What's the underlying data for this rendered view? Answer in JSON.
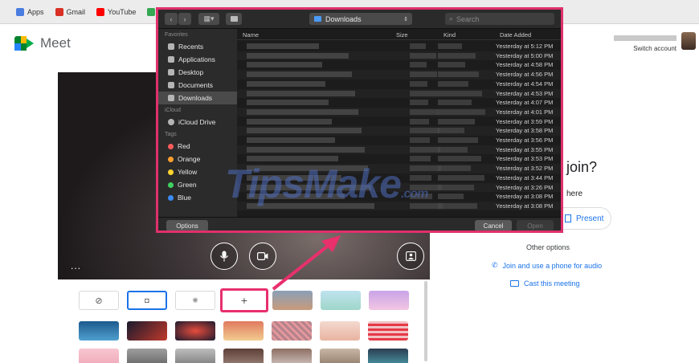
{
  "bookmarks": [
    {
      "label": "Apps",
      "color": "#4a7de0",
      "icon": "apps-grid-icon"
    },
    {
      "label": "Gmail",
      "color": "#d93025",
      "icon": "gmail-icon"
    },
    {
      "label": "YouTube",
      "color": "#ff0000",
      "icon": "youtube-icon"
    },
    {
      "label": "Maps",
      "color": "#34a853",
      "icon": "maps-icon"
    }
  ],
  "meet": {
    "app_name": "Meet",
    "switch_account": "Switch account",
    "join_prompt": "join?",
    "join_here": "here",
    "present_label": "Present",
    "other_options": "Other options",
    "phone_audio": "Join and use a phone for audio",
    "cast": "Cast this meeting"
  },
  "video": {
    "more_dots": "..."
  },
  "background_picker": {
    "add_label": "+",
    "accent": "#e8306d"
  },
  "dialog": {
    "location": "Downloads",
    "search_placeholder": "Search",
    "columns": {
      "name": "Name",
      "size": "Size",
      "kind": "Kind",
      "date": "Date Added"
    },
    "favorites_heading": "Favorites",
    "favorites": [
      "Recents",
      "Applications",
      "Desktop",
      "Documents",
      "Downloads"
    ],
    "selected_favorite": "Downloads",
    "icloud_heading": "iCloud",
    "icloud": [
      "iCloud Drive"
    ],
    "tags_heading": "Tags",
    "tags": [
      {
        "label": "Red",
        "color": "#ff5b5b"
      },
      {
        "label": "Orange",
        "color": "#ff9f2e"
      },
      {
        "label": "Yellow",
        "color": "#ffd52e"
      },
      {
        "label": "Green",
        "color": "#3fd160"
      },
      {
        "label": "Blue",
        "color": "#3a8cf5"
      }
    ],
    "dates": [
      "Yesterday at 5:12 PM",
      "Yesterday at 5:00 PM",
      "Yesterday at 4:58 PM",
      "Yesterday at 4:56 PM",
      "Yesterday at 4:54 PM",
      "Yesterday at 4:53 PM",
      "Yesterday at 4:07 PM",
      "Yesterday at 4:01 PM",
      "Yesterday at 3:59 PM",
      "Yesterday at 3:58 PM",
      "Yesterday at 3:56 PM",
      "Yesterday at 3:55 PM",
      "Yesterday at 3:53 PM",
      "Yesterday at 3:52 PM",
      "Yesterday at 3:44 PM",
      "Yesterday at 3:26 PM",
      "Yesterday at 3:08 PM",
      "Yesterday at 3:08 PM"
    ],
    "options_label": "Options",
    "cancel_label": "Cancel",
    "open_label": "Open",
    "highlight_color": "#e0306d"
  },
  "watermark": {
    "main": "TipsMake",
    "suffix": ".com"
  }
}
